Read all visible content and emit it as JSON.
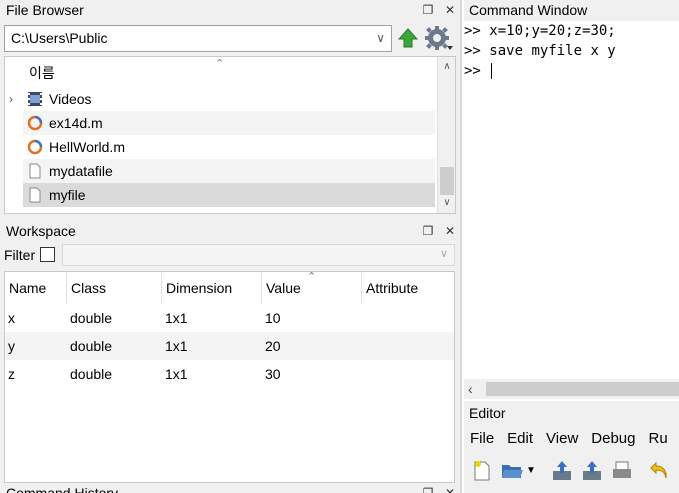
{
  "file_browser": {
    "title": "File Browser",
    "path": "C:\\Users\\Public",
    "column_header": "이름",
    "items": [
      {
        "name": "Videos",
        "type": "folder"
      },
      {
        "name": "ex14d.m",
        "type": "m-file"
      },
      {
        "name": "HellWorld.m",
        "type": "m-file"
      },
      {
        "name": "mydatafile",
        "type": "file"
      },
      {
        "name": "myfile",
        "type": "file"
      }
    ]
  },
  "workspace": {
    "title": "Workspace",
    "filter_label": "Filter",
    "columns": [
      "Name",
      "Class",
      "Dimension",
      "Value",
      "Attribute"
    ],
    "rows": [
      {
        "name": "x",
        "class": "double",
        "dimension": "1x1",
        "value": "10",
        "attribute": ""
      },
      {
        "name": "y",
        "class": "double",
        "dimension": "1x1",
        "value": "20",
        "attribute": ""
      },
      {
        "name": "z",
        "class": "double",
        "dimension": "1x1",
        "value": "30",
        "attribute": ""
      }
    ]
  },
  "command_history": {
    "title": "Command History"
  },
  "command_window": {
    "title": "Command Window",
    "lines": [
      {
        "prompt": ">>",
        "text": "x=10;y=20;z=30;"
      },
      {
        "prompt": ">>",
        "text": "save myfile x y"
      },
      {
        "prompt": ">>",
        "text": ""
      }
    ]
  },
  "editor": {
    "title": "Editor",
    "menu": [
      "File",
      "Edit",
      "View",
      "Debug",
      "Ru"
    ]
  },
  "colors": {
    "panel_bg": "#f0f0f0",
    "selected_row": "#dadada",
    "up_arrow": "#3aa63a",
    "m_file_icon": "#e07020"
  }
}
